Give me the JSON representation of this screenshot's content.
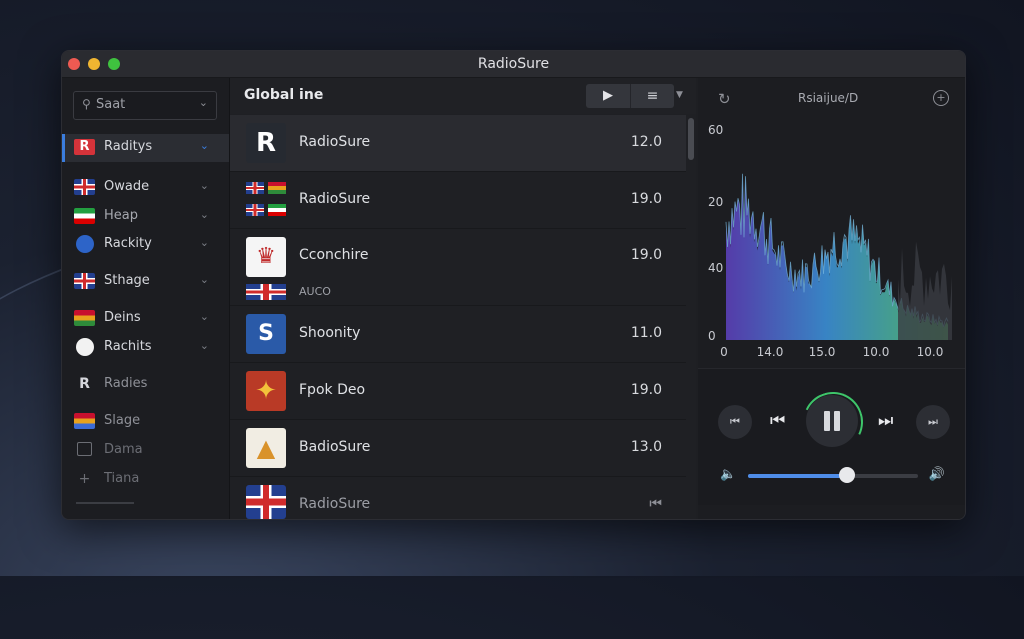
{
  "window": {
    "title": "RadioSure"
  },
  "sidebar": {
    "search_placeholder": "Saat",
    "items": [
      {
        "label": "Raditys",
        "icon": "radio-r-icon",
        "active": true
      },
      {
        "label": "Owade",
        "icon": "uk-flag-icon"
      },
      {
        "label": "Heap",
        "icon": "iran-flag-icon"
      },
      {
        "label": "Rackity",
        "icon": "globe-icon"
      },
      {
        "label": "Sthage",
        "icon": "uk-flag-icon"
      },
      {
        "label": "Deins",
        "icon": "flag-icon"
      },
      {
        "label": "Rachits",
        "icon": "globe-icon"
      },
      {
        "label": "Radies",
        "icon": "radio-r-icon"
      },
      {
        "label": "Slage",
        "icon": "flag-icon"
      },
      {
        "label": "Dama",
        "icon": "square-icon"
      },
      {
        "label": "Tiana",
        "icon": "plus-icon"
      }
    ]
  },
  "list": {
    "title": "Global ine",
    "rows": [
      {
        "name": "RadioSure",
        "value": "12.0",
        "logo": "radiosure-logo"
      },
      {
        "name": "RadioSure",
        "value": "19.0",
        "logo": "flags-logo"
      },
      {
        "name": "Cconchire",
        "value": "19.0",
        "logo": "fire-logo",
        "sub": "AUCO"
      },
      {
        "name": "Shoonity",
        "value": "11.0",
        "logo": "blue-logo"
      },
      {
        "name": "Fpok Deo",
        "value": "19.0",
        "logo": "star-logo"
      },
      {
        "name": "BadioSure",
        "value": "13.0",
        "logo": "triangle-logo"
      },
      {
        "name": "RadioSure",
        "value": "",
        "logo": "uk-flag-logo"
      }
    ]
  },
  "right": {
    "station_title": "Rsiaijue/D",
    "volume": 0.58,
    "accent": "#3ec56a",
    "volume_color": "#4f8de8"
  },
  "chart_data": {
    "type": "area",
    "y_ticks": [
      "60",
      "20",
      "40",
      "0"
    ],
    "x_ticks": [
      "0",
      "14.0",
      "15.0",
      "10.0",
      "10.0"
    ],
    "series_colors": [
      "#5b3fb8",
      "#3b8fd6",
      "#55c46a"
    ]
  }
}
